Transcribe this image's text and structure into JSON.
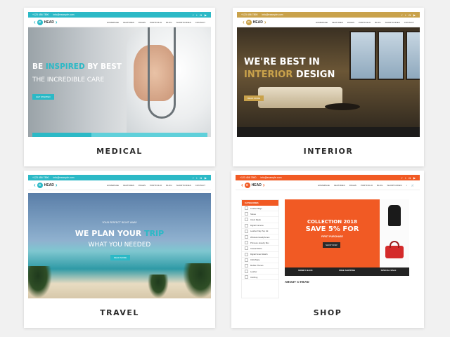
{
  "colors": {
    "medical_accent": "#2cb9c6",
    "interior_accent": "#c9a24b",
    "travel_accent": "#2cb9c6",
    "shop_accent": "#f15a24"
  },
  "icons": [
    "chevron-left-icon",
    "chevron-right-icon",
    "facebook-icon",
    "twitter-icon",
    "search-icon",
    "cart-icon"
  ],
  "topbar": {
    "phone": "+123 456 7890",
    "email": "info@example.com"
  },
  "brand": {
    "badge": "C",
    "name": "HEAD"
  },
  "menu": [
    "HOMEPAGE",
    "FEATURES",
    "PAGES",
    "PORTFOLIO",
    "BLOG",
    "SHORTCODES",
    "CONTACT"
  ],
  "cards": [
    {
      "caption": "MEDICAL",
      "hero_line1_a": "BE ",
      "hero_line1_b": "INSPIRED",
      "hero_line1_c": " BY BEST",
      "hero_line2": "THE INCREDIBLE CARE",
      "button": "GET STARTED"
    },
    {
      "caption": "INTERIOR",
      "hero_line1": "WE'RE BEST IN",
      "hero_line2_a": "INTERIOR",
      "hero_line2_b": " DESIGN",
      "button": "READ MORE"
    },
    {
      "caption": "TRAVEL",
      "hero_small": "YOUR PERFECT RIGHT AWAY",
      "hero_line1_a": "WE PLAN YOUR ",
      "hero_line1_b": "TRIP",
      "hero_line2": "WHAT YOU NEEDED",
      "button": "READ MORE"
    },
    {
      "caption": "SHOP",
      "sidebar_title": "CATEGORIES",
      "categories": [
        "Leather Bags",
        "Shoes",
        "Clock Radio",
        "Digital Camera",
        "Leather Flap Top Ink",
        "Wireless Headphones",
        "Princess Jewelry Box",
        "Casual Shirts",
        "Digital Smart Watch",
        "Child Mate",
        "Mobile Phones",
        "Leather",
        "Clothing"
      ],
      "banner_title": "COLLECTION 2018",
      "banner_offer": "SAVE 5% FOR",
      "banner_sub": "FIRST PURCHASE",
      "banner_button": "SHOP NOW",
      "features": [
        "MONEY BACK",
        "FREE SHIPPING",
        "SPECIAL SALE"
      ],
      "about": "ABOUT C-HEAD"
    }
  ]
}
